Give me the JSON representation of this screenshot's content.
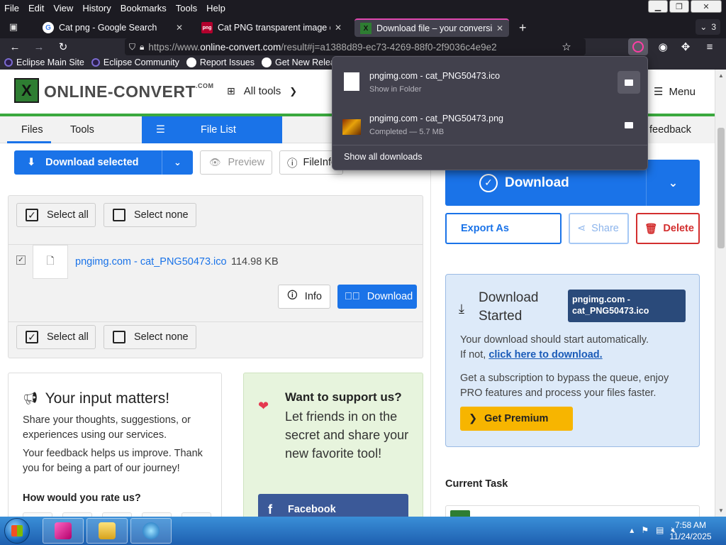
{
  "menubar": {
    "items": [
      "File",
      "Edit",
      "View",
      "History",
      "Bookmarks",
      "Tools",
      "Help"
    ]
  },
  "tabs": [
    {
      "title": "Cat png - Google Search",
      "favicon": "google-icon"
    },
    {
      "title": "Cat PNG transparent image dow",
      "favicon": "pngimg-icon"
    },
    {
      "title": "Download file – your conversion",
      "favicon": "online-convert-icon",
      "active": true
    }
  ],
  "tab_count": "3",
  "url": {
    "prefix": "https://www.",
    "domain": "online-convert.com",
    "path": "/result#j=a1388d89-ec73-4269-88f0-2f9036c4e9e2"
  },
  "bookmarks": [
    {
      "label": "Eclipse Main Site",
      "icon": "eclipse-icon"
    },
    {
      "label": "Eclipse Community",
      "icon": "eclipse-icon"
    },
    {
      "label": "Report Issues",
      "icon": "github-icon"
    },
    {
      "label": "Get New Releases",
      "icon": "github-icon"
    }
  ],
  "downloads_panel": {
    "items": [
      {
        "name": "pngimg.com - cat_PNG50473.ico",
        "status": "Show in Folder"
      },
      {
        "name": "pngimg.com - cat_PNG50473.png",
        "status": "Completed — 5.7 MB"
      }
    ],
    "show_all": "Show all downloads"
  },
  "site": {
    "logo": "ONLINE-CONVERT",
    "logo_suffix": ".COM",
    "all_tools": "All tools",
    "menu": "Menu",
    "feedback": "feedback"
  },
  "subnav": {
    "files": "Files",
    "tools": "Tools",
    "file_list": "File List"
  },
  "toolbar": {
    "download_selected": "Download selected",
    "preview": "Preview",
    "file_info": "FileInfo"
  },
  "files": {
    "select_all": "Select all",
    "select_none": "Select none",
    "file_name": "pngimg.com - cat_PNG50473.ico",
    "file_size": "114.98 KB",
    "info": "Info",
    "download": "Download"
  },
  "feedback_card": {
    "title": "Your input matters!",
    "p1": "Share your thoughts, suggestions, or experiences using our services.",
    "p2": "Your feedback helps us improve. Thank you for being a part of our journey!",
    "rate": "How would you rate us?"
  },
  "support_card": {
    "title": "Want to support us?",
    "body": "Let friends in on the secret and share your new favorite tool!",
    "facebook": "Facebook"
  },
  "right": {
    "download": "Download",
    "export_as": "Export As",
    "share": "Share",
    "delete": "Delete",
    "started_title": "Download Started",
    "file_badge": "pngimg.com - cat_PNG50473.ico",
    "auto_line": "Your download should start automatically.",
    "ifnot": "If not, ",
    "click_here": "click here to download.",
    "subscription": "Get a subscription to bypass the queue, enjoy PRO features and process your files faster.",
    "premium": "Get Premium",
    "current_task": "Current Task"
  },
  "taskbar": {
    "time": "7:58 AM",
    "date": "11/24/2025"
  }
}
